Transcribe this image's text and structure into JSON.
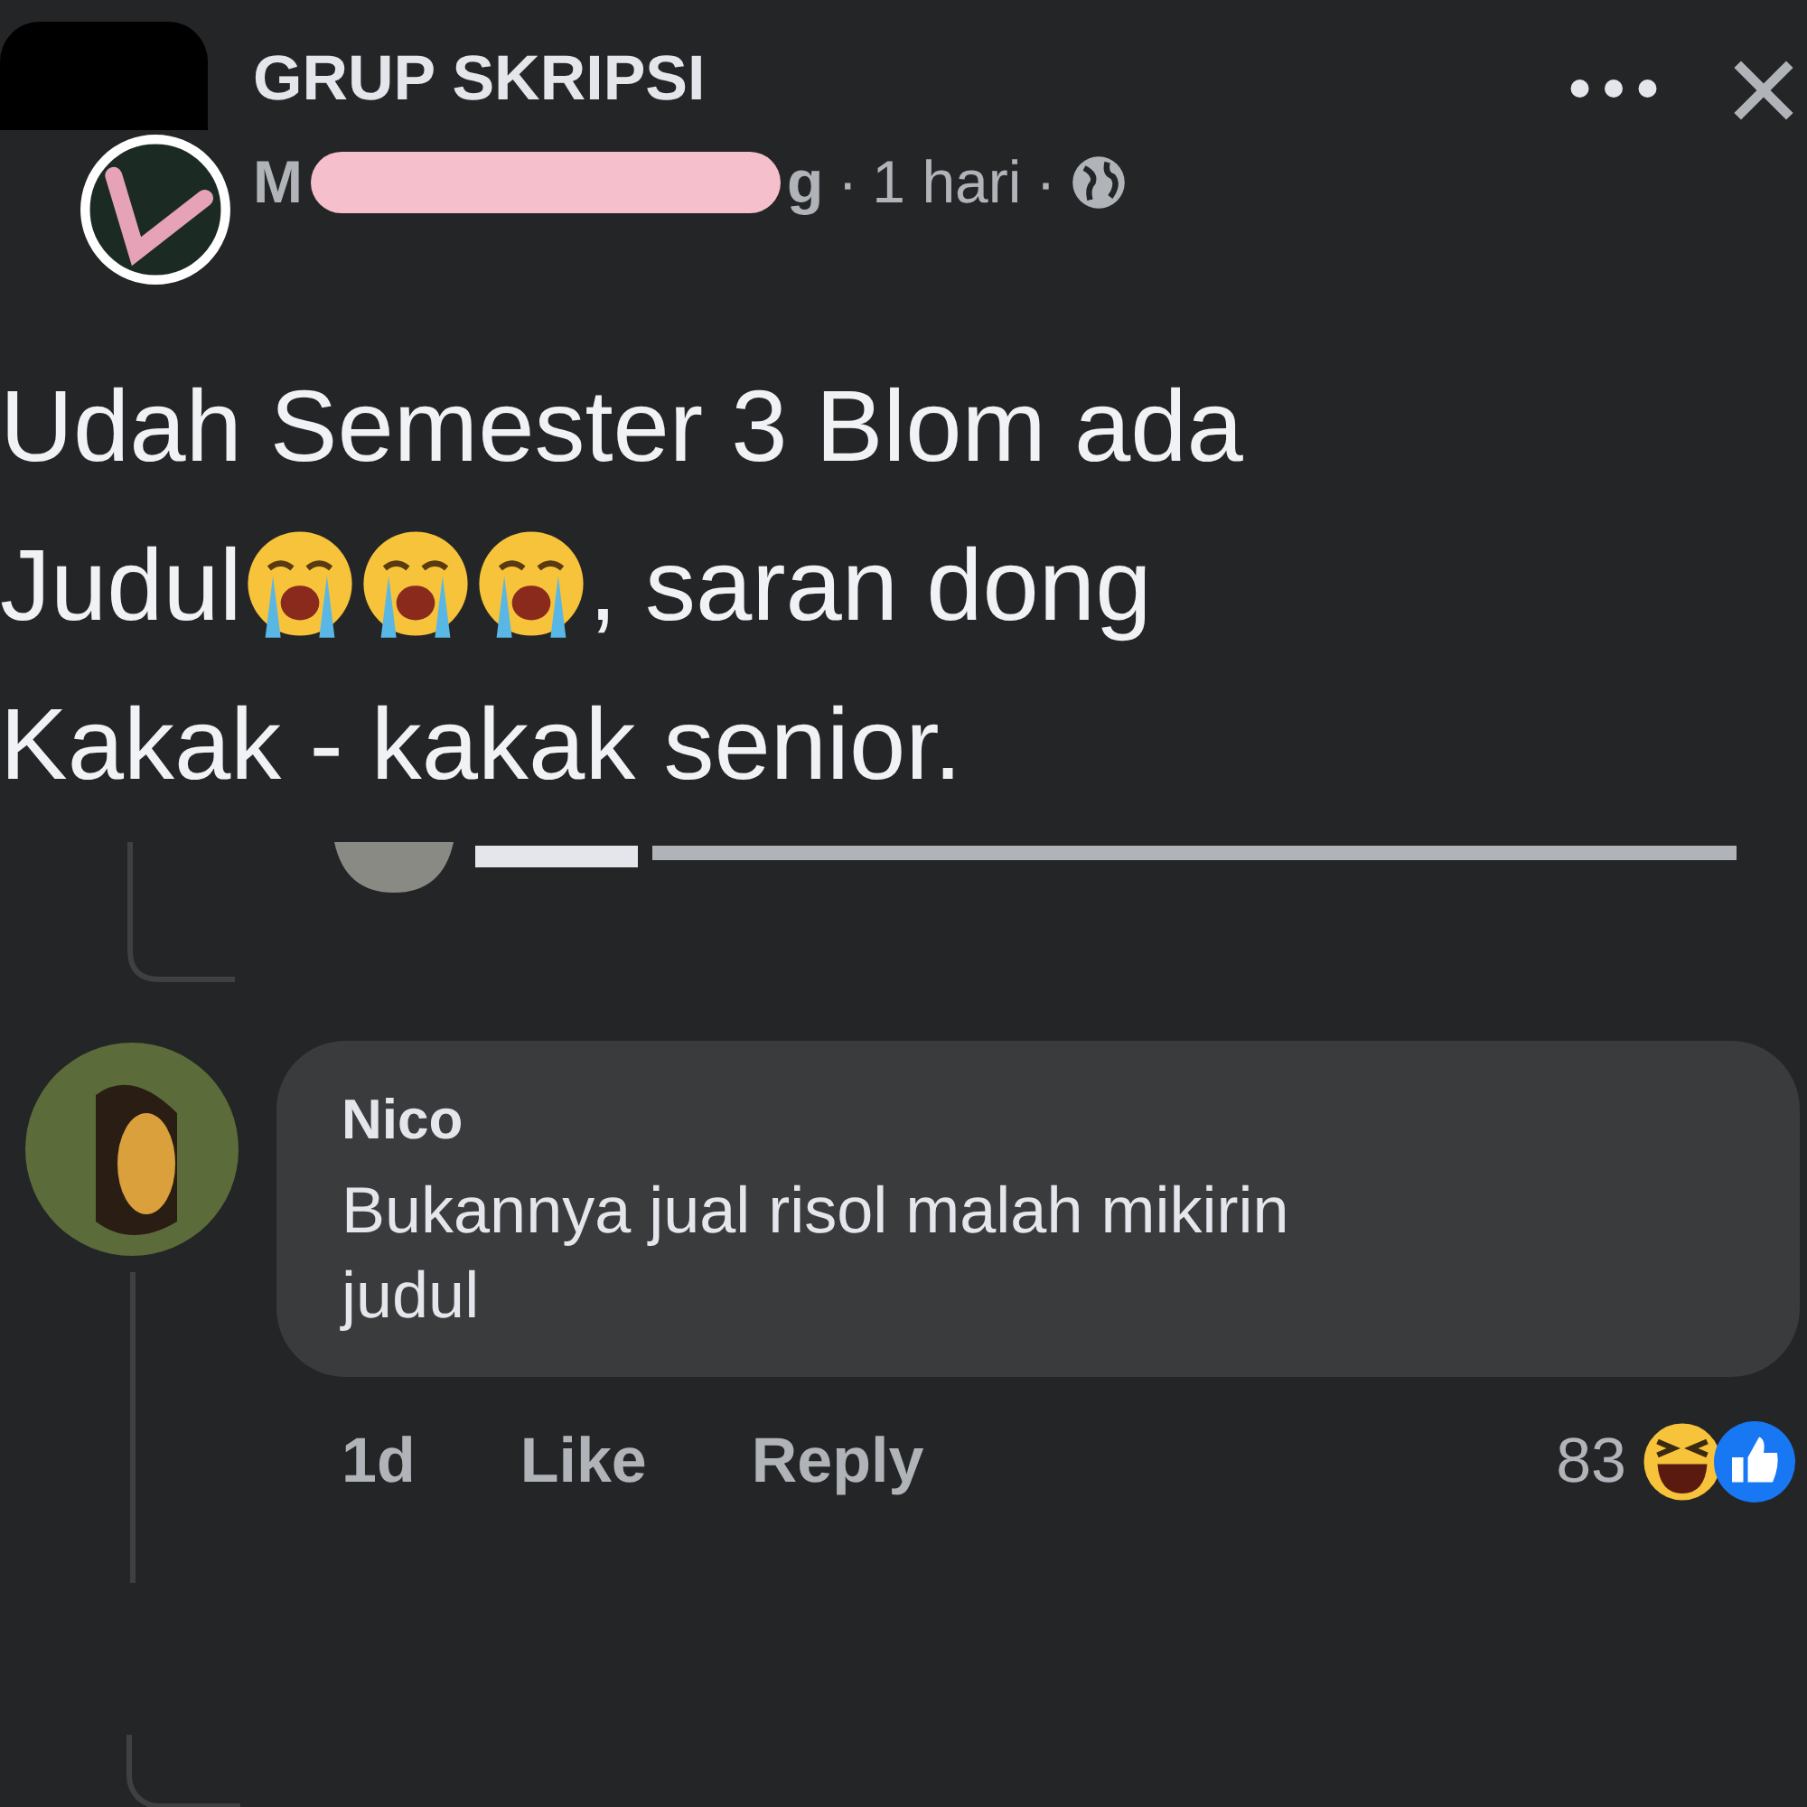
{
  "post": {
    "group": "GRUP SKRIPSI",
    "author_start": "M",
    "author_end": "g",
    "separator_1": "·",
    "time": "1 hari",
    "separator_2": "·",
    "text": [
      {
        "kind": "text",
        "text": "Udah Semester 3 Blom ada Judul"
      },
      {
        "kind": "emoji"
      },
      {
        "kind": "emoji"
      },
      {
        "kind": "emoji"
      },
      {
        "kind": "text",
        "text": ", saran dong Kakak - kakak senior."
      }
    ]
  },
  "comment": {
    "author": "Nico",
    "text": "Bukannya jual risol malah mikirin judul",
    "time": "1d",
    "actions": [
      "Like",
      "Reply"
    ],
    "reaction_count": "83",
    "reactions": [
      {
        "kind": "haha"
      },
      {
        "kind": "like"
      }
    ]
  }
}
